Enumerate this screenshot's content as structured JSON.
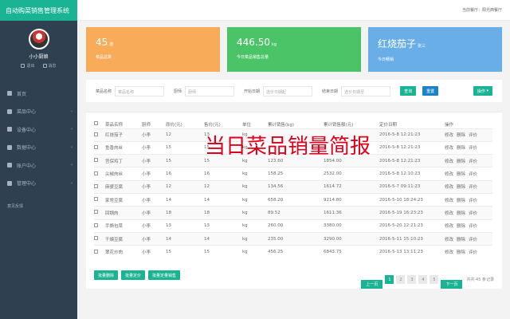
{
  "app_title": "自动购菜销售管理系统",
  "topbar": {
    "current_branch": "当前餐厅：阳光西餐厅"
  },
  "profile": {
    "name": "小小厨娘",
    "logout": "退出",
    "message": "消息"
  },
  "nav": [
    {
      "label": "首页",
      "has_chevron": false
    },
    {
      "label": "菜品中心",
      "has_chevron": true
    },
    {
      "label": "设备中心",
      "has_chevron": true
    },
    {
      "label": "数据中心",
      "has_chevron": true
    },
    {
      "label": "账户中心",
      "has_chevron": true
    },
    {
      "label": "管理中心",
      "has_chevron": true
    }
  ],
  "nav_footer": "意见反馈",
  "cards": [
    {
      "value": "45",
      "unit": "道",
      "label": "菜品总数",
      "color": "#f8ac59"
    },
    {
      "value": "446.50",
      "unit": "kg",
      "label": "今日菜品销售总量",
      "color": "#4bc468"
    },
    {
      "value": "红烧茄子",
      "unit": "张三",
      "label": "今日畅销",
      "color": "#6aaee8"
    }
  ],
  "filter": {
    "dish_label": "菜品名称",
    "dish_placeholder": "菜品名称",
    "chef_label": "厨师",
    "chef_placeholder": "厨师",
    "start_label": "开始日期",
    "start_placeholder": "选价日期起",
    "end_label": "结束日期",
    "end_placeholder": "选价日期至",
    "search_btn": "查询",
    "reset_btn": "重置",
    "action_btn": "操作"
  },
  "overlay_title": "当日菜品销量简报",
  "table": {
    "headers": [
      "",
      "菜品名称",
      "厨师",
      "原价(元)",
      "售价(元)",
      "单位",
      "累计销售(kg)",
      "累计销售额(元)",
      "定价日期",
      "操作"
    ],
    "rows": [
      [
        "红烧茄子",
        "小李",
        "12",
        "13",
        "kg",
        "",
        "",
        "2016-5-8 12:21:23"
      ],
      [
        "鱼香肉丝",
        "小李",
        "15",
        "15",
        "kg",
        "",
        "",
        "2016-5-8 12:21:23"
      ],
      [
        "宫保鸡丁",
        "小李",
        "15",
        "15",
        "kg",
        "123.60",
        "1854.00",
        "2016-5-8 12:21:23"
      ],
      [
        "尖椒肉丝",
        "小李",
        "16",
        "16",
        "kg",
        "158.25",
        "2532.00",
        "2016-5-8 12:10:23"
      ],
      [
        "麻婆豆腐",
        "小李",
        "12",
        "12",
        "kg",
        "134.56",
        "1614.72",
        "2016-5-7 09:11:23"
      ],
      [
        "家常豆腐",
        "小李",
        "14",
        "14",
        "kg",
        "658.20",
        "9214.80",
        "2016-5-10 18:24:23"
      ],
      [
        "回锅肉",
        "小李",
        "18",
        "18",
        "kg",
        "89.52",
        "1611.36",
        "2016-5-19 16:23:23"
      ],
      [
        "手撕包菜",
        "小李",
        "13",
        "13",
        "kg",
        "260.00",
        "3380.00",
        "2016-5-20 12:21:23"
      ],
      [
        "干煸豆腐",
        "小李",
        "14",
        "14",
        "kg",
        "235.00",
        "3290.00",
        "2016-5-11 15:10:23"
      ],
      [
        "翠花炒肉",
        "小李",
        "15",
        "15",
        "kg",
        "456.25",
        "6843.75",
        "2016-5-13 13:11:23"
      ]
    ],
    "ops": [
      "修改",
      "删除",
      "评价"
    ]
  },
  "bottom_buttons": [
    "批量删除",
    "批量定价",
    "批量定量销售"
  ],
  "pager": {
    "prev": "上一页",
    "pages": [
      "1",
      "2",
      "3",
      "4",
      "5"
    ],
    "next": "下一页",
    "total": "共共 45 条记录"
  }
}
